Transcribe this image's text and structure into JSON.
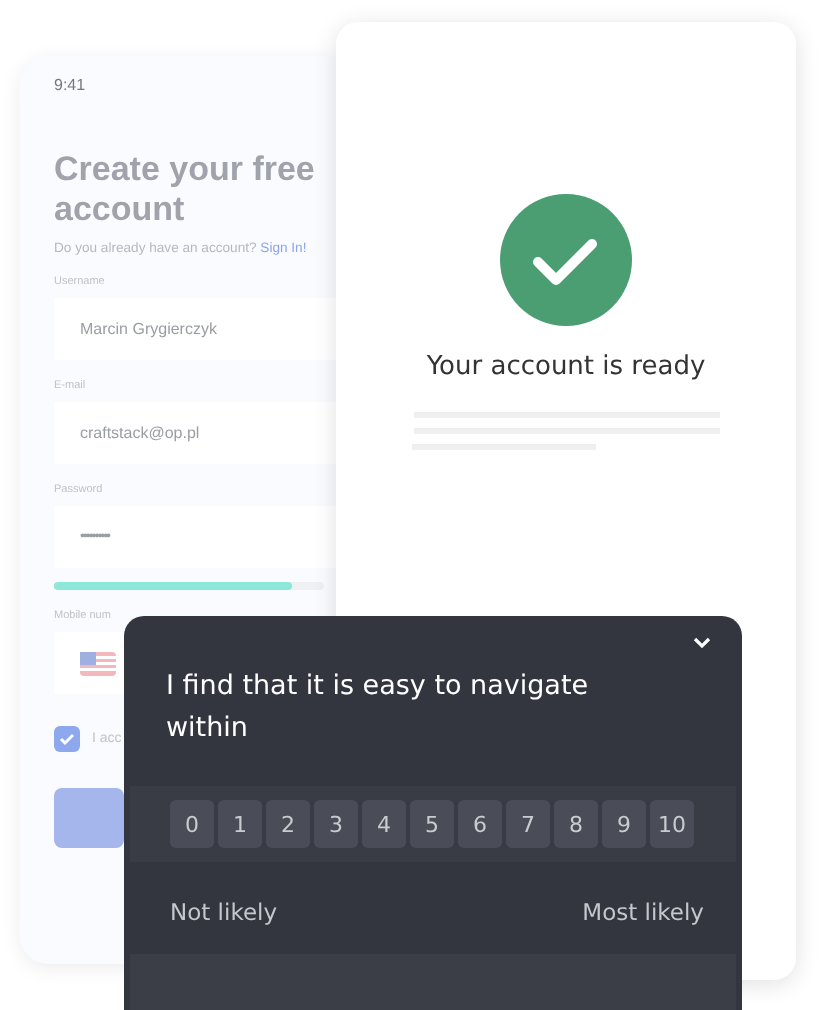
{
  "signup": {
    "time": "9:41",
    "title": "Create your free account",
    "subtitle": "Do you already have an account?",
    "signin_link": "Sign In!",
    "fields": [
      {
        "label": "Username",
        "value": "Marcin Grygierczyk",
        "kind": "text"
      },
      {
        "label": "E-mail",
        "value": "craftstack@op.pl",
        "kind": "text"
      },
      {
        "label": "Password",
        "value": "••••••••••",
        "kind": "password"
      },
      {
        "label": "Mobile num",
        "kind": "phone"
      }
    ],
    "strength": {
      "level": 0.88
    },
    "terms": {
      "label": "I acc",
      "checked": true
    }
  },
  "success": {
    "message": "Your account is ready"
  },
  "survey": {
    "question": "I find that it is easy to navigate within",
    "scale": [
      "0",
      "1",
      "2",
      "3",
      "4",
      "5",
      "6",
      "7",
      "8",
      "9",
      "10"
    ],
    "low_label": "Not likely",
    "high_label": "Most likely"
  }
}
